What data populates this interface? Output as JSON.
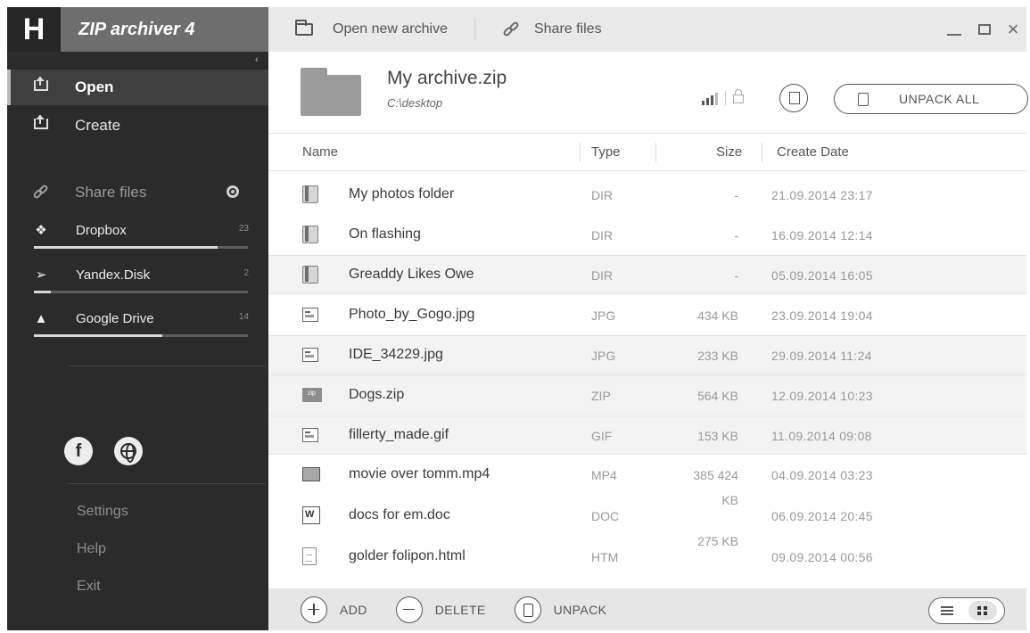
{
  "app": {
    "logo_letter": "H",
    "title": "ZIP archiver 4"
  },
  "toolbar": {
    "open_new_archive": "Open new archive",
    "share_files": "Share files"
  },
  "sidebar": {
    "nav": [
      {
        "label": "Open",
        "active": true
      },
      {
        "label": "Create",
        "active": false
      }
    ],
    "share_label": "Share files",
    "clouds": [
      {
        "name": "Dropbox",
        "count": "23",
        "usage": 0.86,
        "icon": "dropbox-icon"
      },
      {
        "name": "Yandex.Disk",
        "count": "2",
        "usage": 0.08,
        "icon": "yandex-disk-icon"
      },
      {
        "name": "Google Drive",
        "count": "14",
        "usage": 0.6,
        "icon": "google-drive-icon"
      }
    ],
    "footer": [
      "Settings",
      "Help",
      "Exit"
    ]
  },
  "archive": {
    "name": "My archive.zip",
    "path": "C:\\desktop",
    "unpack_all": "UNPACK ALL"
  },
  "table": {
    "headers": {
      "name": "Name",
      "type": "Type",
      "size": "Size",
      "date": "Create Date"
    },
    "rows": [
      {
        "name": "My photos folder",
        "type": "DIR",
        "size": "-",
        "date": "21.09.2014  23:17",
        "icon": "folder-icon",
        "shaded": false
      },
      {
        "name": "On flashing",
        "type": "DIR",
        "size": "-",
        "date": "16.09.2014  12:14",
        "icon": "folder-icon",
        "shaded": false
      },
      {
        "name": "Greaddy Likes Owe",
        "type": "DIR",
        "size": "-",
        "date": "05.09.2014  16:05",
        "icon": "folder-icon",
        "shaded": true
      },
      {
        "name": "Photo_by_Gogo.jpg",
        "type": "JPG",
        "size": "434 KB",
        "date": "23.09.2014  19:04",
        "icon": "image-file-icon",
        "shaded": false
      },
      {
        "name": "IDE_34229.jpg",
        "type": "JPG",
        "size": "233 KB",
        "date": "29.09.2014  11:24",
        "icon": "image-file-icon",
        "shaded": true
      },
      {
        "name": "Dogs.zip",
        "type": "ZIP",
        "size": "564 KB",
        "date": "12.09.2014  10:23",
        "icon": "zip-file-icon",
        "shaded": true
      },
      {
        "name": "fillerty_made.gif",
        "type": "GIF",
        "size": "153 KB",
        "date": "11.09.2014  09:08",
        "icon": "image-file-icon",
        "shaded": true
      },
      {
        "name": "movie over tomm.mp4",
        "type": "MP4",
        "size": "385 424",
        "date": "04.09.2014  03:23",
        "icon": "video-file-icon",
        "shaded": false
      },
      {
        "name": "docs for em.doc",
        "type": "DOC",
        "size": "KB",
        "date": "06.09.2014  20:45",
        "icon": "word-document-icon",
        "shaded": false
      },
      {
        "name": "golder folipon.html",
        "type": "HTM",
        "size": "275 KB",
        "date": "09.09.2014  00:56",
        "icon": "html-file-icon",
        "shaded": false
      }
    ]
  },
  "bottombar": {
    "add": "ADD",
    "delete": "DELETE",
    "unpack": "UNPACK"
  }
}
